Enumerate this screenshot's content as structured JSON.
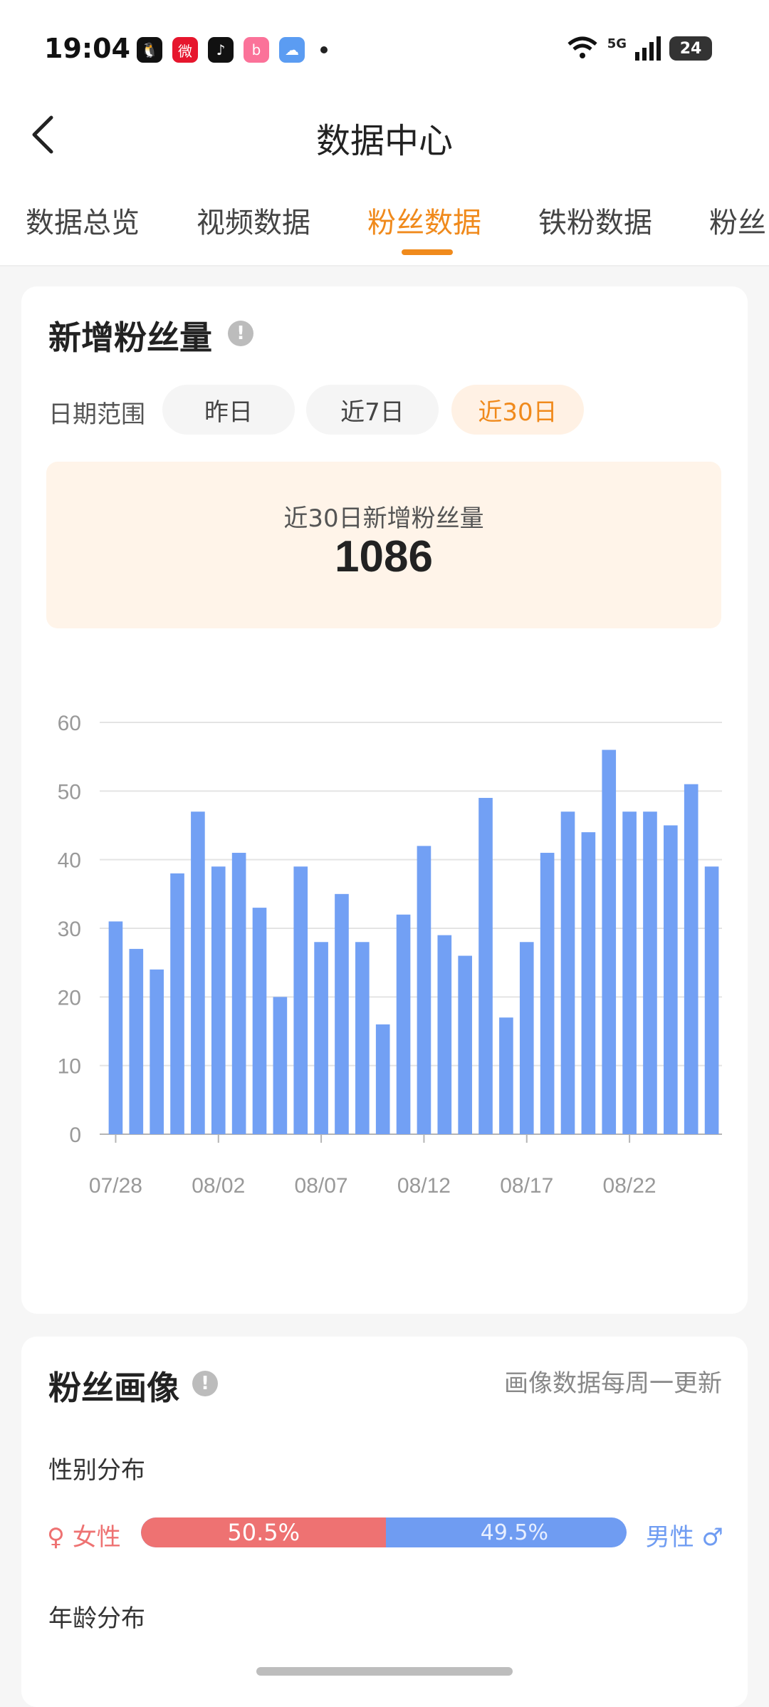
{
  "status_bar": {
    "time": "19:04",
    "apps": [
      {
        "icon": "qq-icon",
        "color": "#111111",
        "glyph": "🐧"
      },
      {
        "icon": "weibo-icon",
        "color": "#e6162d",
        "glyph": "微"
      },
      {
        "icon": "douyin-icon",
        "color": "#111111",
        "glyph": "♪"
      },
      {
        "icon": "bilibili-icon",
        "color": "#fb7299",
        "glyph": "b"
      },
      {
        "icon": "weather-icon",
        "color": "#5b9cf2",
        "glyph": "☁"
      }
    ],
    "network": "5G",
    "battery": "24"
  },
  "nav": {
    "title": "数据中心"
  },
  "tabs": [
    {
      "label": "数据总览",
      "active": false
    },
    {
      "label": "视频数据",
      "active": false
    },
    {
      "label": "粉丝数据",
      "active": true
    },
    {
      "label": "铁粉数据",
      "active": false
    },
    {
      "label": "粉丝",
      "active": false
    }
  ],
  "fans_growth": {
    "title": "新增粉丝量",
    "range_label": "日期范围",
    "ranges": [
      {
        "label": "昨日",
        "active": false
      },
      {
        "label": "近7日",
        "active": false
      },
      {
        "label": "近30日",
        "active": true
      }
    ],
    "summary_label": "近30日新增粉丝量",
    "summary_value": "1086"
  },
  "chart_data": {
    "type": "bar",
    "title": "",
    "xlabel": "",
    "ylabel": "",
    "ylim": [
      0,
      60
    ],
    "yticks": [
      0,
      10,
      20,
      30,
      40,
      50,
      60
    ],
    "xtick_labels": [
      "07/28",
      "08/02",
      "08/07",
      "08/12",
      "08/17",
      "08/22"
    ],
    "categories": [
      "07/28",
      "07/29",
      "07/30",
      "07/31",
      "08/01",
      "08/02",
      "08/03",
      "08/04",
      "08/05",
      "08/06",
      "08/07",
      "08/08",
      "08/09",
      "08/10",
      "08/11",
      "08/12",
      "08/13",
      "08/14",
      "08/15",
      "08/16",
      "08/17",
      "08/18",
      "08/19",
      "08/20",
      "08/21",
      "08/22",
      "08/23",
      "08/24",
      "08/25",
      "08/26"
    ],
    "values": [
      31,
      27,
      24,
      38,
      47,
      39,
      41,
      33,
      20,
      39,
      28,
      35,
      28,
      16,
      32,
      42,
      29,
      26,
      49,
      17,
      28,
      41,
      47,
      44,
      56,
      47,
      47,
      45,
      51,
      39
    ],
    "bar_color": "#72a0f4",
    "grid": true
  },
  "fans_profile": {
    "title": "粉丝画像",
    "update_note": "画像数据每周一更新",
    "gender_label": "性别分布",
    "female_label": "♀ 女性",
    "male_label": "男性 ♂",
    "female_percent": 50.5,
    "female_percent_text": "50.5%",
    "male_percent_text": "49.5%",
    "female_color": "#ee7272",
    "male_color": "#6f9cf2",
    "age_label": "年龄分布"
  }
}
